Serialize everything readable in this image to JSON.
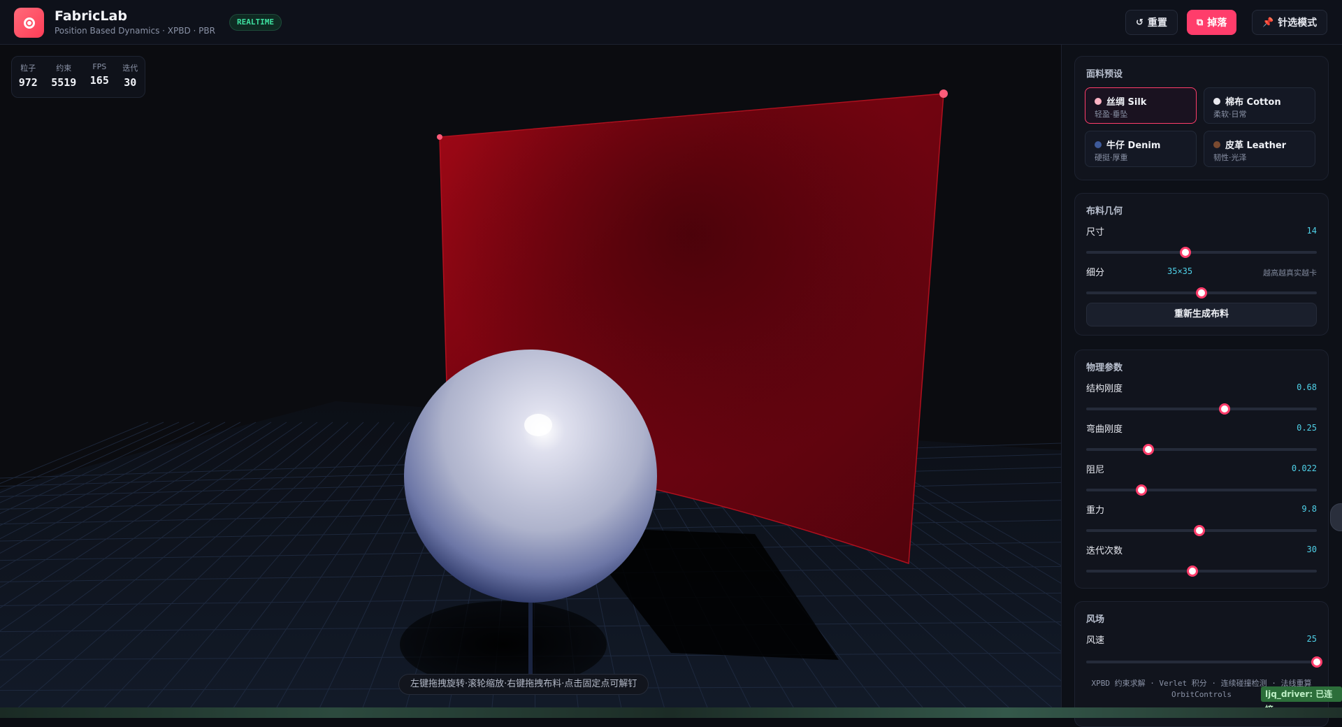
{
  "header": {
    "title": "FabricLab",
    "subtitle": "Position Based Dynamics · XPBD · PBR",
    "badge": "REALTIME",
    "buttons": {
      "reset": "重置",
      "drop": "掉落",
      "pin": "针选模式"
    }
  },
  "stats": [
    {
      "label": "粒子",
      "value": "972"
    },
    {
      "label": "约束",
      "value": "5519"
    },
    {
      "label": "FPS",
      "value": "165"
    },
    {
      "label": "迭代",
      "value": "30"
    }
  ],
  "hint": "左键拖拽旋转·滚轮缩放·右键拖拽布料·点击固定点可解钉",
  "presets": {
    "title": "面料预设",
    "items": [
      {
        "name": "丝绸 Silk",
        "desc": "轻盈·垂坠",
        "color": "#ffb3c4",
        "active": true
      },
      {
        "name": "棉布 Cotton",
        "desc": "柔软·日常",
        "color": "#e8e8ee",
        "active": false
      },
      {
        "name": "牛仔 Denim",
        "desc": "硬挺·厚重",
        "color": "#3e5a9a",
        "active": false
      },
      {
        "name": "皮革 Leather",
        "desc": "韧性·光泽",
        "color": "#7a4a30",
        "active": false
      }
    ]
  },
  "geometry": {
    "title": "布料几何",
    "size_label": "尺寸",
    "size_value": "14",
    "size_level": 0.43,
    "subdiv_label": "细分",
    "subdiv_value": "35×35",
    "subdiv_note": "越高越真实越卡",
    "subdiv_level": 0.5,
    "regen": "重新生成布料"
  },
  "physics": {
    "title": "物理参数",
    "params": [
      {
        "label": "结构刚度",
        "value": "0.68",
        "level": 0.6
      },
      {
        "label": "弯曲刚度",
        "value": "0.25",
        "level": 0.27
      },
      {
        "label": "阻尼",
        "value": "0.022",
        "level": 0.24
      },
      {
        "label": "重力",
        "value": "9.8",
        "level": 0.49
      },
      {
        "label": "迭代次数",
        "value": "30",
        "level": 0.46
      }
    ]
  },
  "wind": {
    "title": "风场",
    "speed_label": "风速",
    "speed_value": "25",
    "speed_level": 1.0
  },
  "footer": {
    "line1": "XPBD 约束求解 · Verlet 积分 · 连续碰撞检测 · 法线重算",
    "line2": "OrbitControls"
  },
  "driver_tag": "ljq_driver: 已连接",
  "colors": {
    "accent": "#ff3d6b",
    "cloth": "#8a0612",
    "value": "#4fd1e8"
  }
}
